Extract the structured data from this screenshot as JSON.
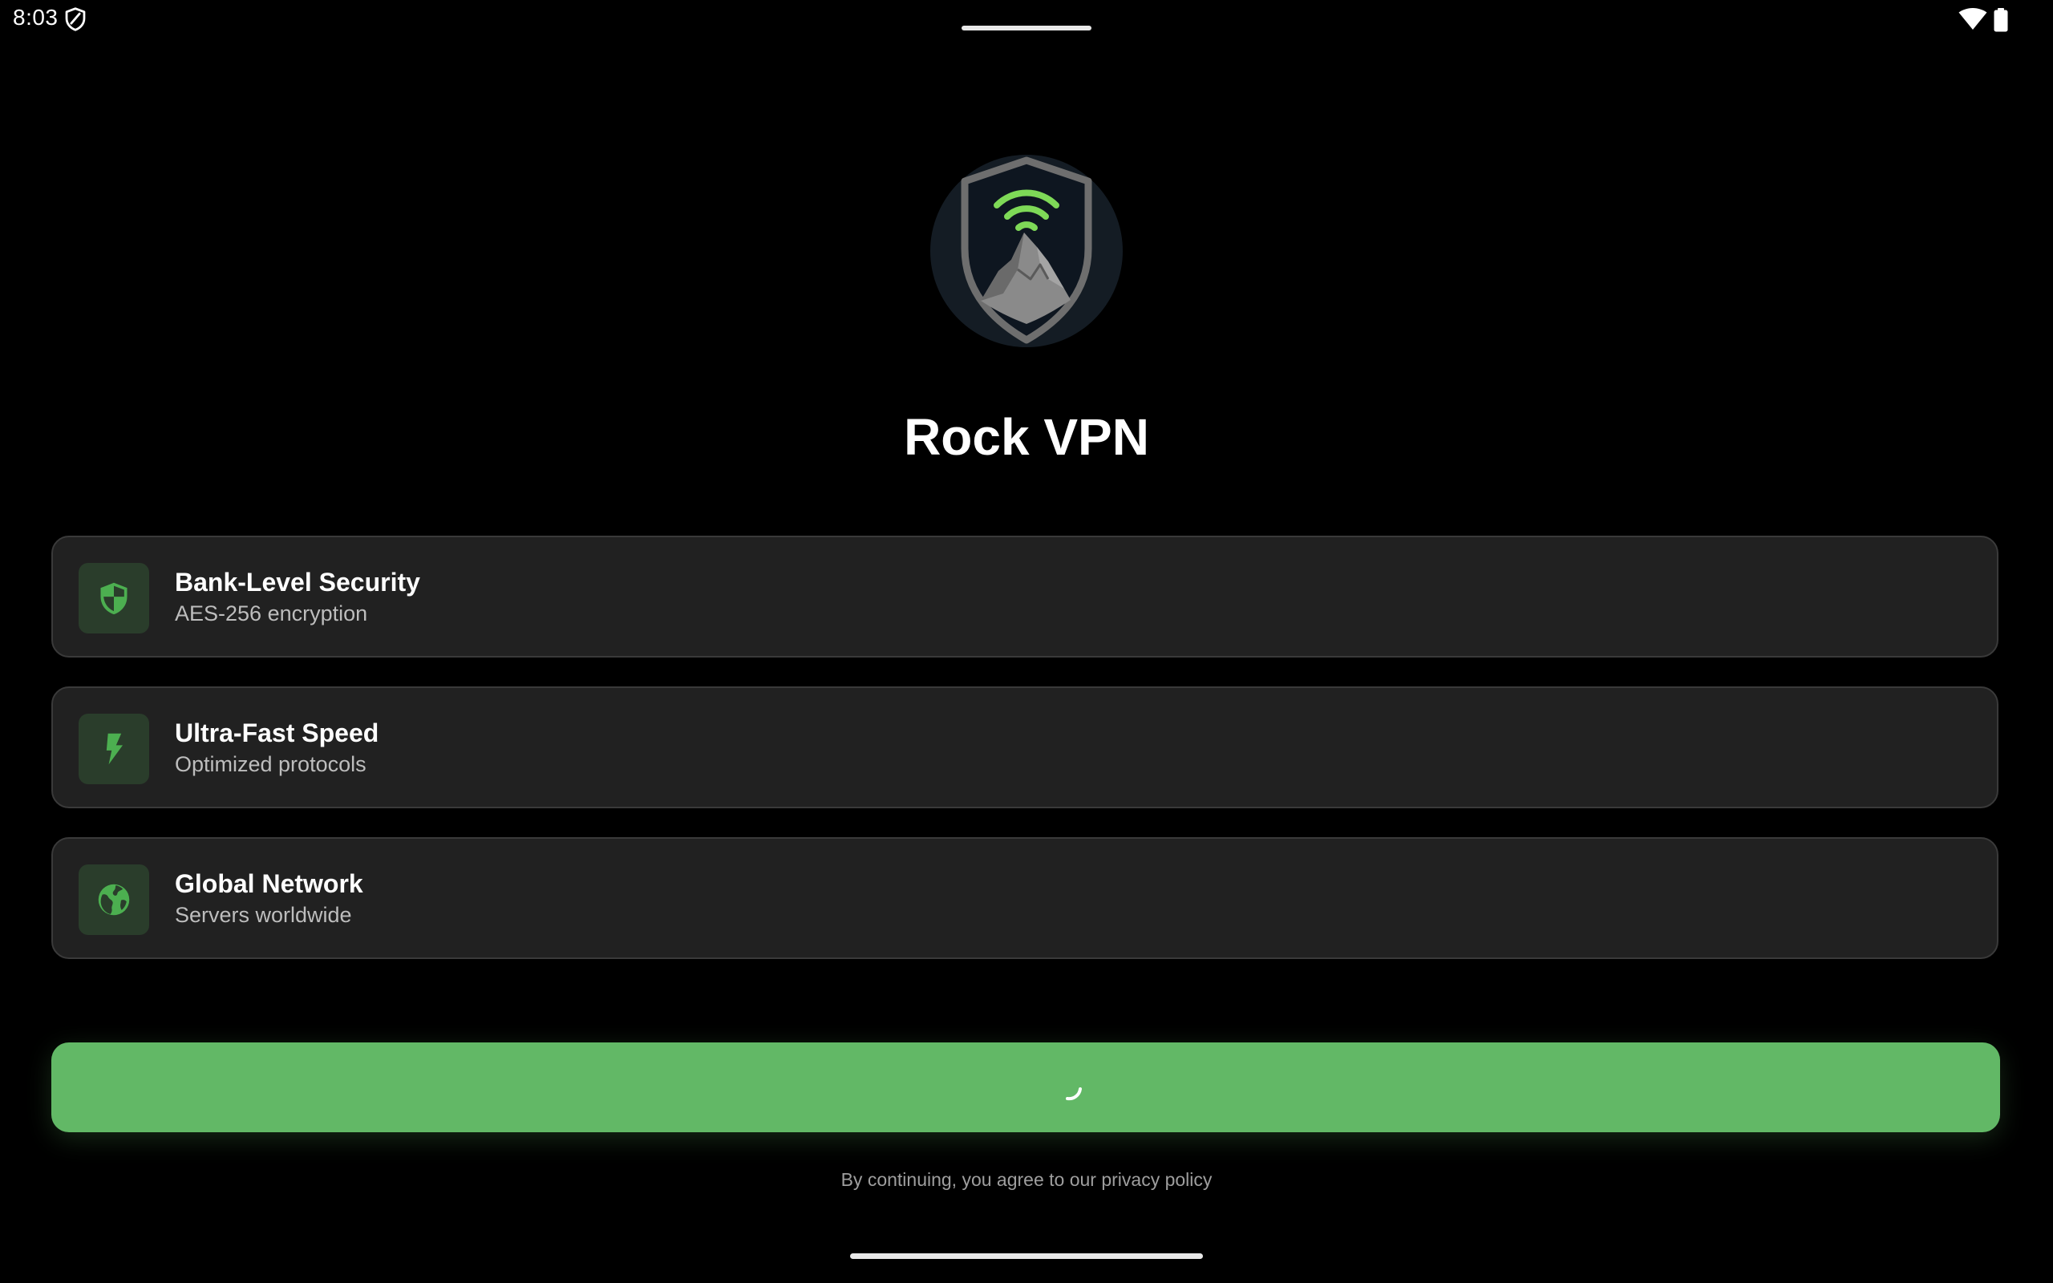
{
  "status_bar": {
    "time": "8:03",
    "icons": [
      "shield-icon",
      "wifi-icon",
      "battery-icon"
    ]
  },
  "app": {
    "title": "Rock VPN",
    "logo": "rock-shield-wifi-logo"
  },
  "features": [
    {
      "icon": "shield-icon",
      "title": "Bank-Level Security",
      "subtitle": "AES-256 encryption"
    },
    {
      "icon": "bolt-icon",
      "title": "Ultra-Fast Speed",
      "subtitle": "Optimized protocols"
    },
    {
      "icon": "globe-icon",
      "title": "Global Network",
      "subtitle": "Servers worldwide"
    }
  ],
  "continue_button": {
    "state": "loading",
    "icon": "spinner-icon"
  },
  "footer": {
    "privacy_text": "By continuing, you agree to our privacy policy"
  },
  "colors": {
    "background": "#000000",
    "card": "#212121",
    "card_border": "#3a3a3a",
    "accent": "#62b866",
    "icon_accent": "#4caf50",
    "icon_box": "#2a3d2b",
    "logo_circle": "#141c24",
    "logo_shield": "#6e6e6e"
  }
}
